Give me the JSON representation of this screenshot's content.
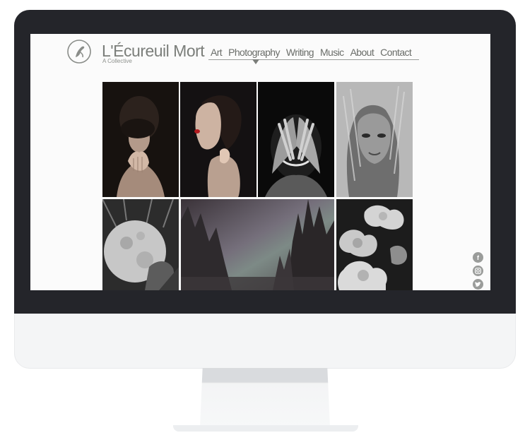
{
  "site": {
    "title": "L'Écureuil Mort",
    "subtitle": "A Collective"
  },
  "nav": {
    "items": [
      {
        "label": "Art"
      },
      {
        "label": "Photography"
      },
      {
        "label": "Writing"
      },
      {
        "label": "Music"
      },
      {
        "label": "About"
      },
      {
        "label": "Contact"
      }
    ],
    "active": "Photography"
  },
  "gallery": {
    "tiles": [
      {
        "subject": "woman with hands at chin, dark background"
      },
      {
        "subject": "woman profile with red lips, hand at neck"
      },
      {
        "subject": "hands covering face, black and white"
      },
      {
        "subject": "woman with blonde hair, black and white"
      },
      {
        "subject": "moon with figure, black and white collage"
      },
      {
        "subject": "misty pine forest"
      },
      {
        "subject": "white roses, black and white"
      }
    ]
  },
  "social": {
    "icons": [
      "facebook-icon",
      "instagram-icon",
      "twitter-icon"
    ]
  }
}
